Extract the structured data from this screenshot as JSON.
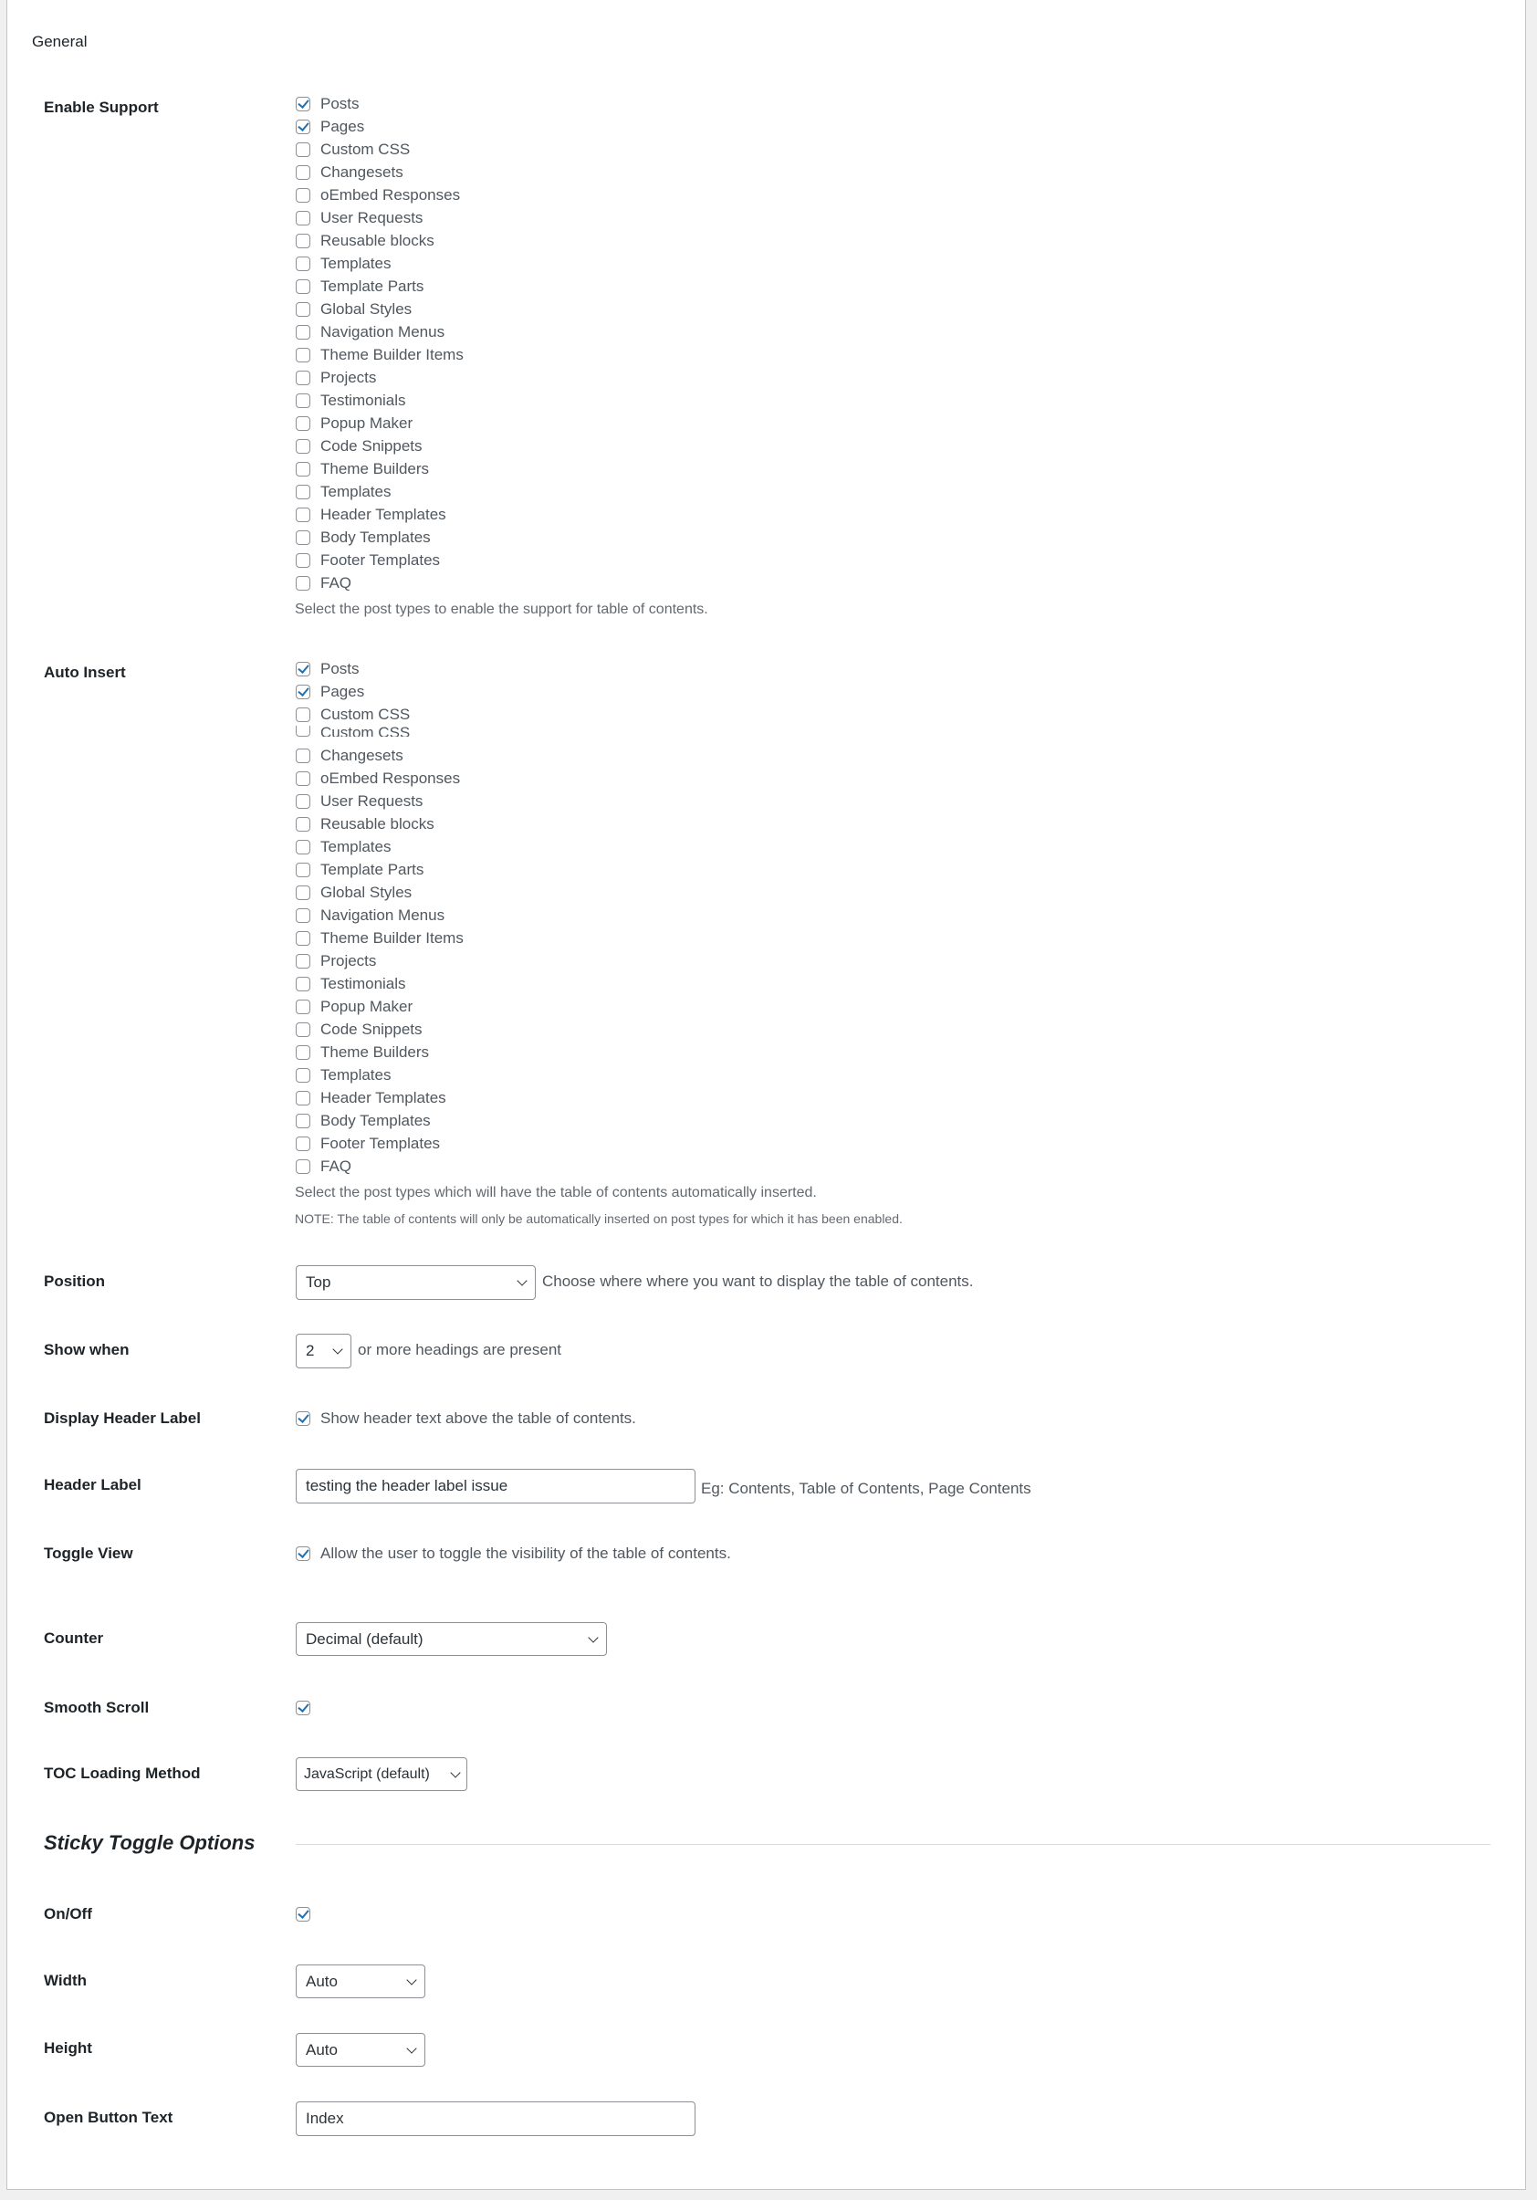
{
  "section_title": "General",
  "enable_support": {
    "label": "Enable Support",
    "items": [
      {
        "label": "Posts",
        "checked": true
      },
      {
        "label": "Pages",
        "checked": true
      },
      {
        "label": "Custom CSS",
        "checked": false
      },
      {
        "label": "Changesets",
        "checked": false
      },
      {
        "label": "oEmbed Responses",
        "checked": false
      },
      {
        "label": "User Requests",
        "checked": false
      },
      {
        "label": "Reusable blocks",
        "checked": false
      },
      {
        "label": "Templates",
        "checked": false
      },
      {
        "label": "Template Parts",
        "checked": false
      },
      {
        "label": "Global Styles",
        "checked": false
      },
      {
        "label": "Navigation Menus",
        "checked": false
      },
      {
        "label": "Theme Builder Items",
        "checked": false
      },
      {
        "label": "Projects",
        "checked": false
      },
      {
        "label": "Testimonials",
        "checked": false
      },
      {
        "label": "Popup Maker",
        "checked": false
      },
      {
        "label": "Code Snippets",
        "checked": false
      },
      {
        "label": "Theme Builders",
        "checked": false
      },
      {
        "label": "Templates",
        "checked": false
      },
      {
        "label": "Header Templates",
        "checked": false
      },
      {
        "label": "Body Templates",
        "checked": false
      },
      {
        "label": "Footer Templates",
        "checked": false
      },
      {
        "label": "FAQ",
        "checked": false
      }
    ],
    "help": "Select the post types to enable the support for table of contents."
  },
  "auto_insert": {
    "label": "Auto Insert",
    "items_top": [
      {
        "label": "Posts",
        "checked": true
      },
      {
        "label": "Pages",
        "checked": true
      },
      {
        "label": "Custom CSS",
        "checked": false
      }
    ],
    "clipped_item": {
      "label": "Custom CSS",
      "checked": false
    },
    "items_bottom": [
      {
        "label": "Changesets",
        "checked": false
      },
      {
        "label": "oEmbed Responses",
        "checked": false
      },
      {
        "label": "User Requests",
        "checked": false
      },
      {
        "label": "Reusable blocks",
        "checked": false
      },
      {
        "label": "Templates",
        "checked": false
      },
      {
        "label": "Template Parts",
        "checked": false
      },
      {
        "label": "Global Styles",
        "checked": false
      },
      {
        "label": "Navigation Menus",
        "checked": false
      },
      {
        "label": "Theme Builder Items",
        "checked": false
      },
      {
        "label": "Projects",
        "checked": false
      },
      {
        "label": "Testimonials",
        "checked": false
      },
      {
        "label": "Popup Maker",
        "checked": false
      },
      {
        "label": "Code Snippets",
        "checked": false
      },
      {
        "label": "Theme Builders",
        "checked": false
      },
      {
        "label": "Templates",
        "checked": false
      },
      {
        "label": "Header Templates",
        "checked": false
      },
      {
        "label": "Body Templates",
        "checked": false
      },
      {
        "label": "Footer Templates",
        "checked": false
      },
      {
        "label": "FAQ",
        "checked": false
      }
    ],
    "help": "Select the post types which will have the table of contents automatically inserted.",
    "note": "NOTE: The table of contents will only be automatically inserted on post types for which it has been enabled."
  },
  "position": {
    "label": "Position",
    "value": "Top",
    "help": "Choose where where you want to display the table of contents."
  },
  "show_when": {
    "label": "Show when",
    "value": "2",
    "suffix": "or more headings are present"
  },
  "display_header_label": {
    "label": "Display Header Label",
    "checked": true,
    "text": "Show header text above the table of contents."
  },
  "header_label": {
    "label": "Header Label",
    "value": "testing the header label issue",
    "help": "Eg: Contents, Table of Contents, Page Contents"
  },
  "toggle_view": {
    "label": "Toggle View",
    "checked": true,
    "text": "Allow the user to toggle the visibility of the table of contents."
  },
  "counter": {
    "label": "Counter",
    "value": "Decimal (default)"
  },
  "smooth_scroll": {
    "label": "Smooth Scroll",
    "checked": true
  },
  "toc_loading": {
    "label": "TOC Loading Method",
    "value": "JavaScript (default)"
  },
  "sticky": {
    "title": "Sticky Toggle Options",
    "on_off": {
      "label": "On/Off",
      "checked": true
    },
    "width": {
      "label": "Width",
      "value": "Auto"
    },
    "height": {
      "label": "Height",
      "value": "Auto"
    },
    "open_button_text": {
      "label": "Open Button Text",
      "value": "Index"
    }
  },
  "colors": {
    "accent": "#2271b1",
    "border": "#8c8f94",
    "help_text": "#646970"
  }
}
